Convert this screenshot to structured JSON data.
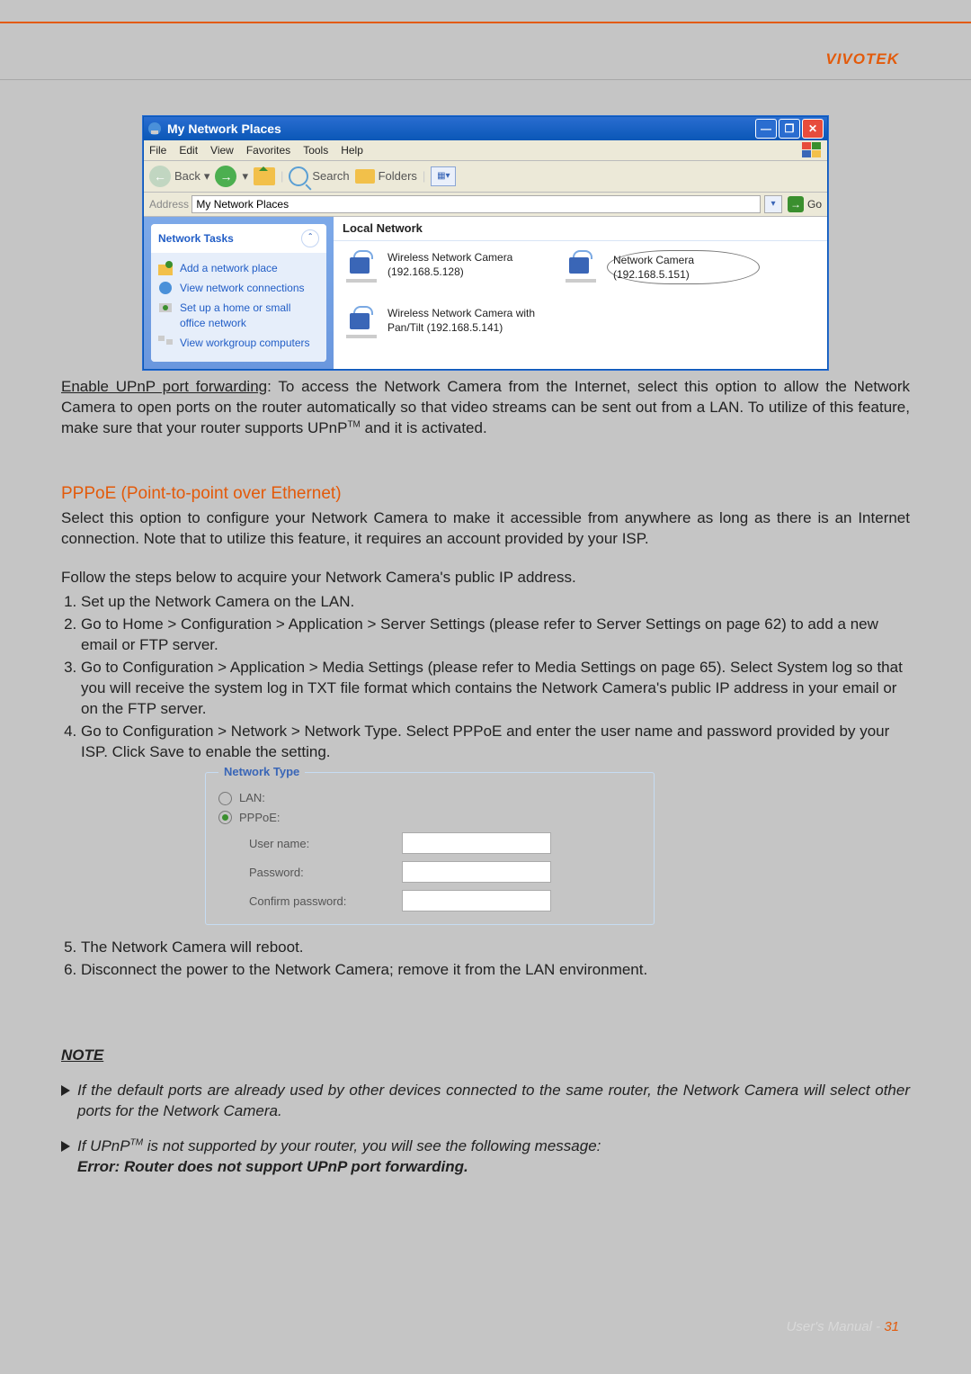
{
  "brand": "VIVOTEK",
  "window": {
    "title": "My Network Places",
    "menu": {
      "file": "File",
      "edit": "Edit",
      "view": "View",
      "favorites": "Favorites",
      "tools": "Tools",
      "help": "Help"
    },
    "toolbar": {
      "back": "Back",
      "search": "Search",
      "folders": "Folders"
    },
    "address": {
      "label": "Address",
      "value": "My Network Places",
      "go": "Go"
    },
    "sidebar": {
      "header": "Network Tasks",
      "items": [
        "Add a network place",
        "View network connections",
        "Set up a home or small office network",
        "View workgroup computers"
      ]
    },
    "group": "Local Network",
    "devices": [
      {
        "name": "Wireless Network Camera (192.168.5.128)"
      },
      {
        "name": "Network Camera (192.168.5.151)"
      },
      {
        "name": "Wireless Network Camera with Pan/Tilt (192.168.5.141)"
      }
    ]
  },
  "para1_lead": "Enable UPnP port forwarding",
  "para1_rest": ": To access the Network Camera from the Internet, select this option to allow the Network Camera to open ports on the router automatically so that video streams can be sent out from a LAN. To utilize of this feature, make sure that your router supports UPnP",
  "para1_tail": " and it is activated.",
  "pppoe_heading": "PPPoE (Point-to-point over Ethernet)",
  "pppoe_intro": "Select this option to configure your Network Camera to make it accessible from anywhere as long as there is an Internet connection. Note that to utilize this feature, it requires an account provided by your ISP.",
  "steps_intro": "Follow the steps below to acquire your Network Camera's public IP address.",
  "steps": [
    "Set up the Network Camera on the LAN.",
    "Go to Home > Configuration > Application > Server Settings (please refer to Server Settings on page 62) to add a new email or FTP server.",
    "Go to Configuration > Application > Media Settings (please refer to Media Settings on page 65). Select System log so that you will receive the system log in TXT file format which contains the Network Camera's public IP address in your email or on the FTP server.",
    "Go to Configuration > Network > Network Type. Select PPPoE and enter the user name and password provided by your ISP. Click Save to enable the setting."
  ],
  "form": {
    "legend": "Network Type",
    "lan": "LAN:",
    "pppoe": "PPPoE:",
    "username": "User name:",
    "password": "Password:",
    "confirm": "Confirm password:"
  },
  "steps_tail": [
    "The Network Camera will reboot.",
    "Disconnect the power to the Network Camera; remove it from the LAN environment."
  ],
  "note_hdr": "NOTE",
  "note1": "If the default ports are already used by other devices connected to the same router, the Network Camera will select other ports for the Network Camera.",
  "note2_a": "If UPnP",
  "note2_b": " is not supported by your router, you will see the following message:",
  "note2_err": "Error: Router does not support UPnP port forwarding.",
  "footer_text": "User's Manual - ",
  "footer_page": "31"
}
